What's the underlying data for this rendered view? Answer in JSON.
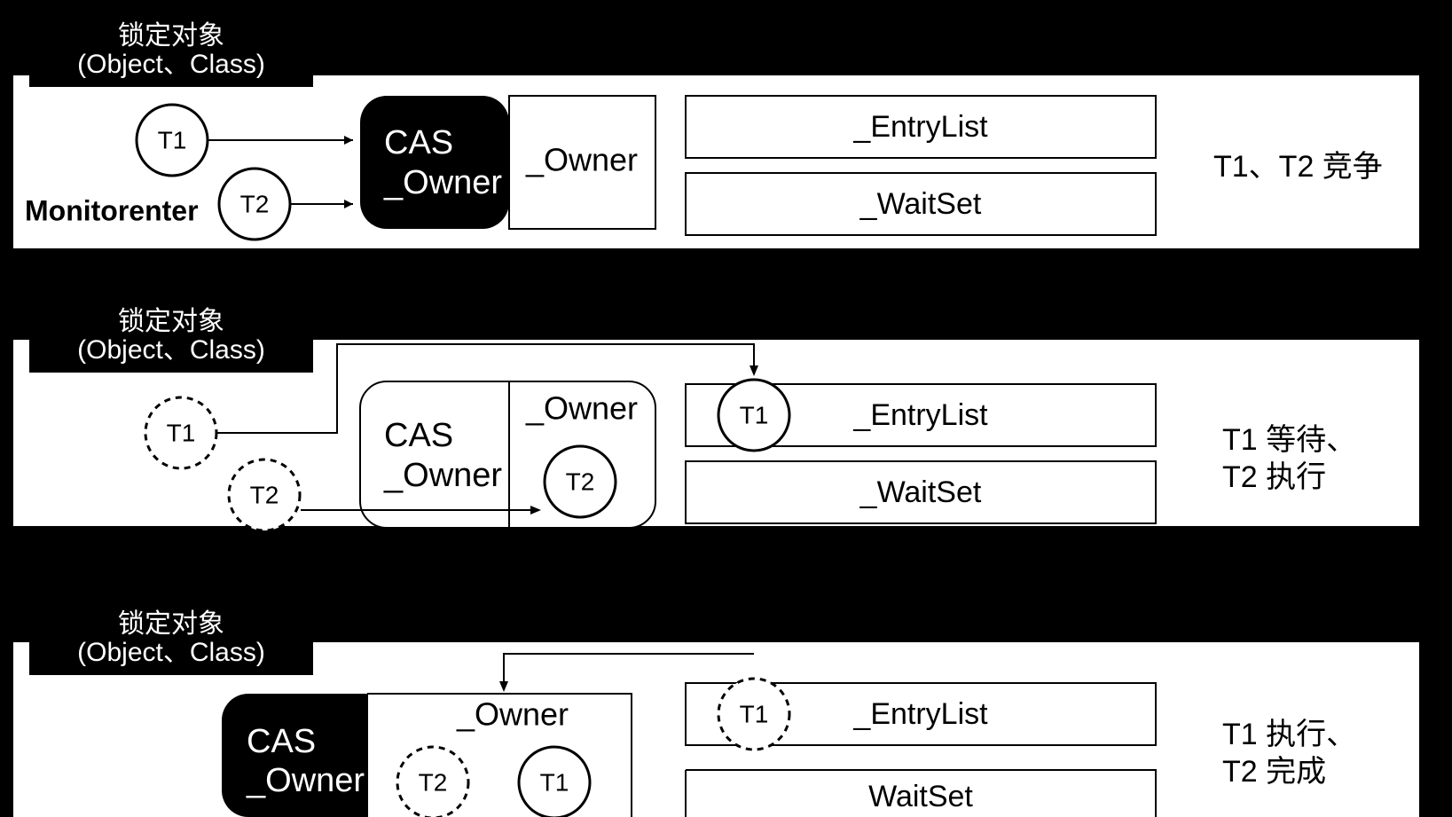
{
  "header": {
    "title_zh": "锁定对象",
    "title_en": "(Object、Class)"
  },
  "thread": {
    "t1": "T1",
    "t2": "T2"
  },
  "monitorenter": "Monitorenter",
  "cas": {
    "l1": "CAS",
    "l2": "_Owner"
  },
  "owner": "_Owner",
  "entrylist": "_EntryList",
  "waitset": "_WaitSet",
  "waitset3": "WaitSet",
  "caption1": "T1、T2 竞争",
  "caption2a": "T1 等待、",
  "caption2b": "T2 执行",
  "caption3a": "T1 执行、",
  "caption3b": "T2 完成"
}
